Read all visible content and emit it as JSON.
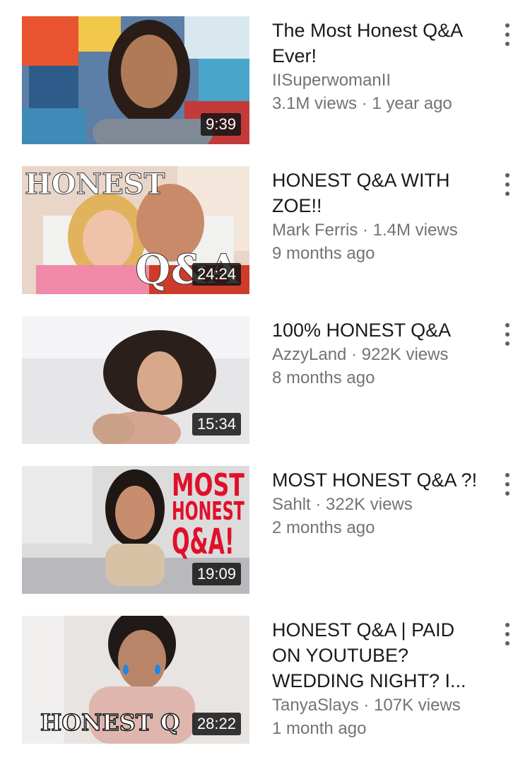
{
  "videos": [
    {
      "title": "The Most Honest Q&A Ever!",
      "channel_line": "IISuperwomanII",
      "stats_line": "3.1M views · 1 year ago",
      "duration": "9:39"
    },
    {
      "title": "HONEST Q&A WITH ZOE!!",
      "channel_line": "Mark Ferris · 1.4M views",
      "stats_line": "9 months ago",
      "duration": "24:24",
      "thumb_text_top": "HONEST",
      "thumb_text_bottom": "Q&A"
    },
    {
      "title": "100% HONEST Q&A",
      "channel_line": "AzzyLand · 922K views",
      "stats_line": "8 months ago",
      "duration": "15:34"
    },
    {
      "title": "MOST HONEST Q&A ?!",
      "channel_line": "Sahlt · 322K views",
      "stats_line": "2 months ago",
      "duration": "19:09",
      "thumb_text": [
        "MOST",
        "HONEST",
        "Q&A!"
      ]
    },
    {
      "title": "HONEST Q&A | PAID ON YOUTUBE? WEDDING NIGHT? I...",
      "channel_line": "TanyaSlays · 107K views",
      "stats_line": "1 month ago",
      "duration": "28:22",
      "thumb_text": "HONEST Q"
    }
  ],
  "icons": {
    "more": "vertical-ellipsis-icon"
  },
  "colors": {
    "title": "#1a1a1a",
    "meta": "#737373",
    "duration_bg": "#141414",
    "accent_red": "#e0102a"
  }
}
